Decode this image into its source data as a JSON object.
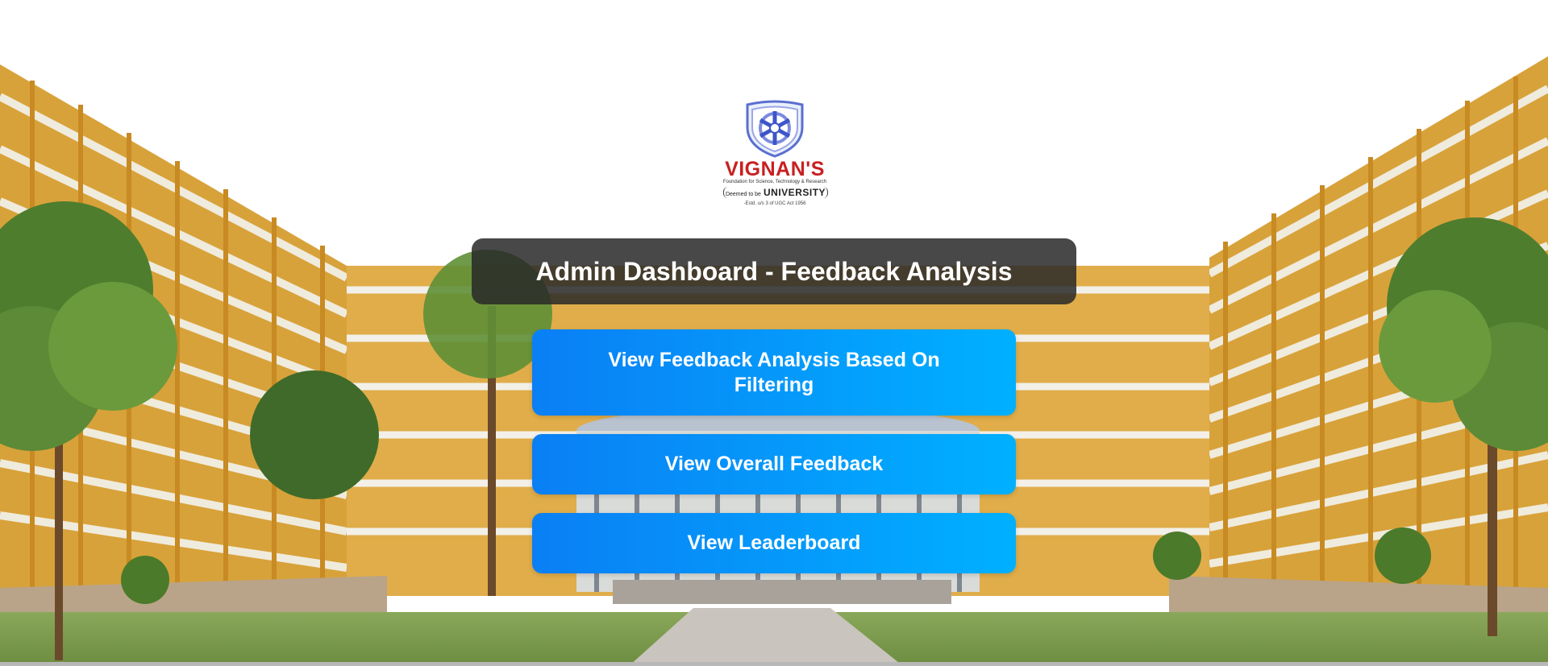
{
  "branding": {
    "name": "VIGNAN'S",
    "tagline": "Foundation for Science, Technology & Research",
    "univ_prefix": "Deemed to be",
    "univ_word": "UNIVERSITY",
    "estd": "-Estd. u/s 3 of UGC Act 1956"
  },
  "header": {
    "title": "Admin Dashboard - Feedback Analysis"
  },
  "actions": [
    {
      "label": "View Feedback Analysis Based On Filtering"
    },
    {
      "label": "View Overall Feedback"
    },
    {
      "label": "View Leaderboard"
    }
  ],
  "colors": {
    "button_start": "#0a7ff5",
    "button_end": "#00b0ff",
    "title_bg": "#282828",
    "brand_red": "#c8201f"
  }
}
